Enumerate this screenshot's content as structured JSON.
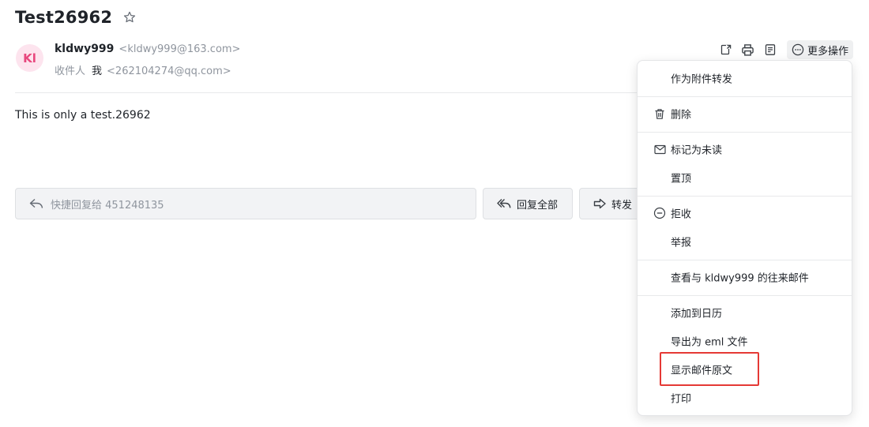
{
  "message": {
    "subject": "Test26962",
    "sender": {
      "initials": "Kl",
      "name": "kldwy999",
      "email": "<kldwy999@163.com>"
    },
    "recipient": {
      "label": "收件人",
      "name": "我",
      "email": "<262104274@qq.com>"
    },
    "body": "This is only a test.26962"
  },
  "toolbar": {
    "icons": [
      "new-window-icon",
      "print-icon",
      "note-icon"
    ],
    "more_label": "更多操作"
  },
  "reply_bar": {
    "quick_reply_placeholder": "快捷回复给 451248135",
    "reply_all_label": "回复全部",
    "forward_label": "转发"
  },
  "more_menu": {
    "items": [
      {
        "label": "作为附件转发",
        "icon": ""
      },
      {
        "label": "删除",
        "icon": "trash-icon"
      },
      {
        "label": "标记为未读",
        "icon": "mail-icon"
      },
      {
        "label": "置顶",
        "icon": ""
      },
      {
        "label": "拒收",
        "icon": "block-icon"
      },
      {
        "label": "举报",
        "icon": ""
      },
      {
        "label": "查看与 kldwy999 的往来邮件",
        "icon": ""
      },
      {
        "label": "添加到日历",
        "icon": ""
      },
      {
        "label": "导出为 eml 文件",
        "icon": ""
      },
      {
        "label": "显示邮件原文",
        "icon": "",
        "highlighted": true
      },
      {
        "label": "打印",
        "icon": ""
      }
    ]
  },
  "colors": {
    "avatar_bg": "#fde4ee",
    "avatar_text": "#e8487e",
    "highlight_border": "#e53935"
  }
}
